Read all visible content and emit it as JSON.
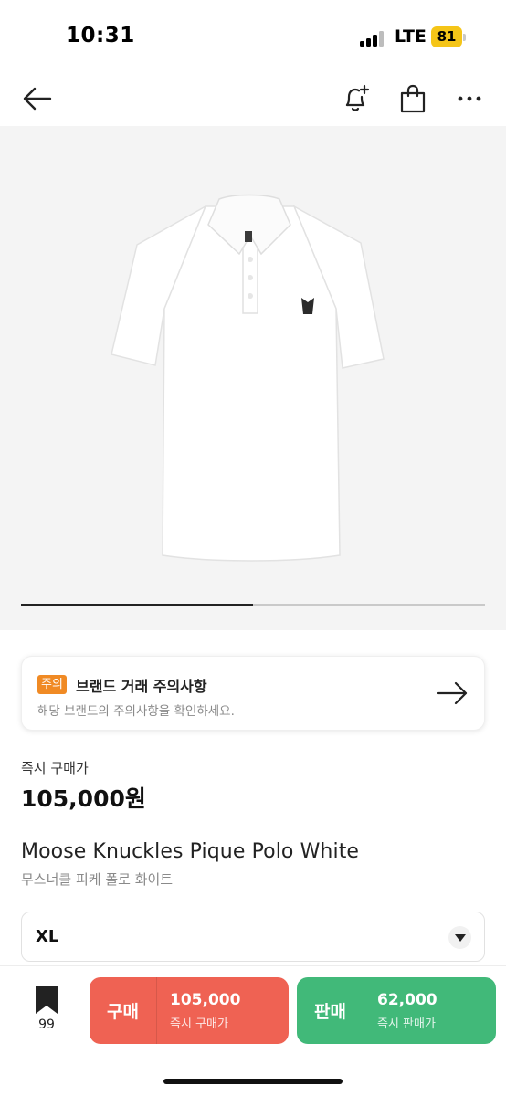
{
  "status_bar": {
    "time": "10:31",
    "network": "LTE",
    "battery": "81"
  },
  "nav": {
    "back_icon": "arrow-left-icon",
    "icons": [
      "bell-plus-icon",
      "shopping-bag-icon",
      "more-horizontal-icon"
    ]
  },
  "gallery": {
    "progress_fraction": 0.5
  },
  "notice": {
    "badge": "주의",
    "title": "브랜드 거래 주의사항",
    "description": "해당 브랜드의 주의사항을 확인하세요."
  },
  "price": {
    "label": "즉시 구매가",
    "value": "105,000원"
  },
  "product": {
    "name": "Moose Knuckles Pique Polo White",
    "name_ko": "무스너클 피케 폴로 화이트"
  },
  "size": {
    "selected": "XL"
  },
  "bottom": {
    "bookmark_count": "99",
    "buy": {
      "label": "구매",
      "price": "105,000",
      "sub": "즉시 구매가",
      "color": "#ef6253"
    },
    "sell": {
      "label": "판매",
      "price": "62,000",
      "sub": "즉시 판매가",
      "color": "#41b979"
    }
  }
}
